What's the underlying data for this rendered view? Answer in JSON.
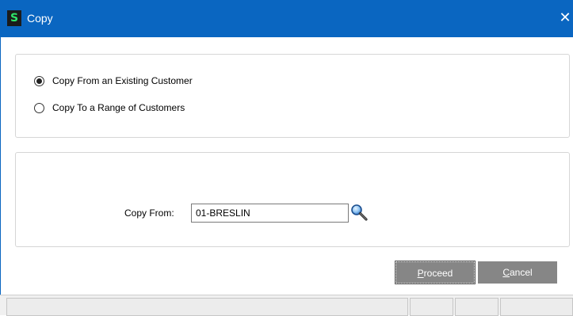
{
  "window": {
    "title": "Copy",
    "icon_glyph": "S",
    "close_glyph": "✕"
  },
  "copy_mode": {
    "options": [
      {
        "label": "Copy From an Existing Customer",
        "selected": true
      },
      {
        "label": "Copy To a Range of Customers",
        "selected": false
      }
    ]
  },
  "copy_from": {
    "label": "Copy From:",
    "value": "01-BRESLIN",
    "lookup_icon": "magnifier-icon"
  },
  "buttons": {
    "proceed": {
      "hotkey": "P",
      "rest": "roceed"
    },
    "cancel": {
      "hotkey": "C",
      "rest": "ancel"
    }
  },
  "colors": {
    "titlebar": "#0a66c1",
    "button": "#868686",
    "app_icon_fg": "#2ee66b"
  }
}
